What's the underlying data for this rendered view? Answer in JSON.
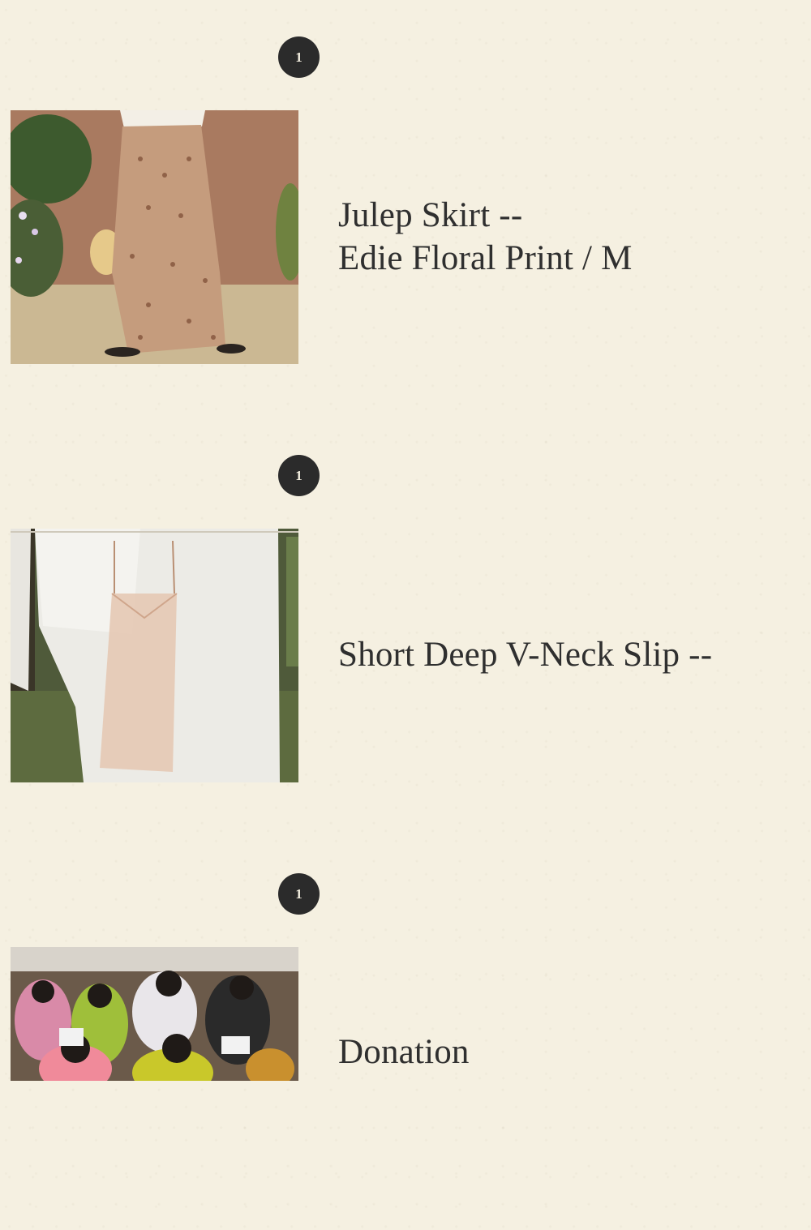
{
  "cart": {
    "items": [
      {
        "quantity": "1",
        "title_line1": "Julep Skirt --",
        "title_line2": "Edie Floral Print / M",
        "image_alt": "Julep Skirt product photo"
      },
      {
        "quantity": "1",
        "title_line1": "Short Deep V-Neck Slip --",
        "title_line2": "",
        "image_alt": "Short Deep V-Neck Slip product photo"
      },
      {
        "quantity": "1",
        "title_line1": "Donation",
        "title_line2": "",
        "image_alt": "Donation photo"
      }
    ]
  },
  "colors": {
    "background": "#f5f0e1",
    "badge": "#2b2b2b",
    "text": "#2f2f2f"
  }
}
